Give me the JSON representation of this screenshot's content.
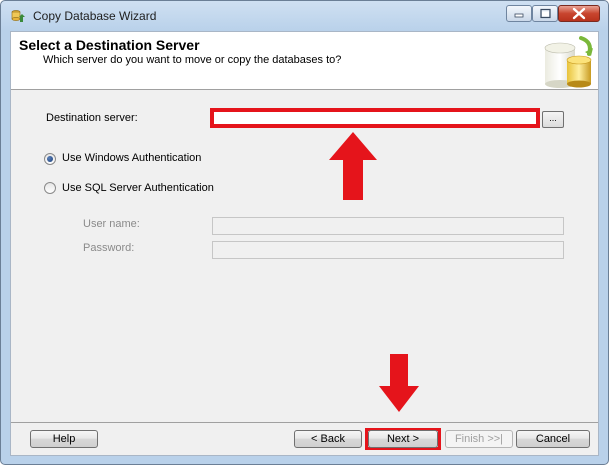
{
  "window": {
    "title": "Copy Database Wizard",
    "minimize_glyph": "—",
    "maximize_glyph": "□",
    "close_glyph": "✕"
  },
  "header": {
    "title": "Select a Destination Server",
    "subtitle": "Which server do you want to move or copy the databases to?"
  },
  "form": {
    "destination_label": "Destination server:",
    "destination_value": "",
    "browse_label": "...",
    "auth_options": [
      {
        "label": "Use Windows Authentication",
        "selected": true
      },
      {
        "label": "Use SQL Server Authentication",
        "selected": false
      }
    ],
    "username_label": "User name:",
    "username_value": "",
    "password_label": "Password:",
    "password_value": ""
  },
  "footer": {
    "help_label": "Help",
    "back_label": "< Back",
    "next_label": "Next >",
    "finish_label": "Finish >>|",
    "cancel_label": "Cancel"
  },
  "annotations": {
    "color": "#e5141b",
    "arrow_up_icon": "arrow-up-icon",
    "arrow_down_icon": "arrow-down-icon"
  }
}
